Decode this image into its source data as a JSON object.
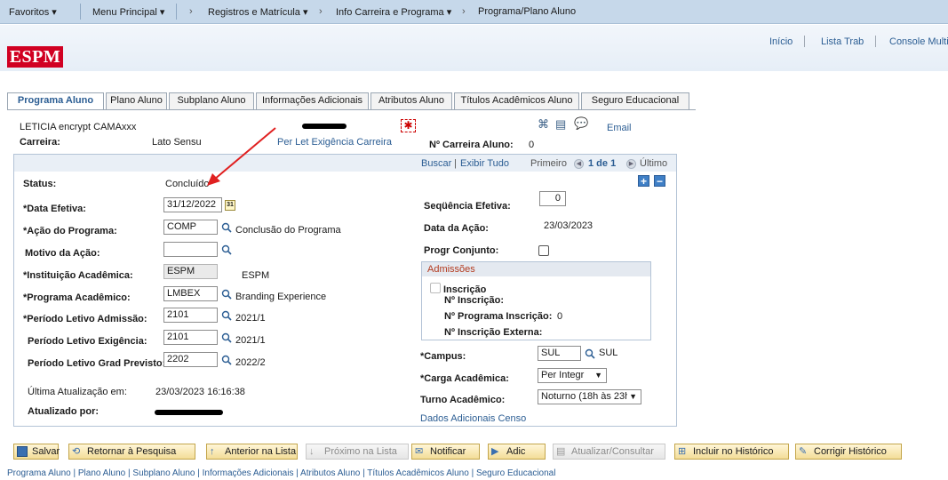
{
  "nav": {
    "favoritos": "Favoritos ▾",
    "menu_principal": "Menu Principal ▾",
    "sep": "›",
    "registros": "Registros e Matrícula ▾",
    "info_carreira": "Info Carreira e Programa ▾",
    "programa_plano": "Programa/Plano Aluno"
  },
  "header": {
    "logo": "ESPM",
    "links": {
      "inicio": "Início",
      "lista_trab": "Lista Trab",
      "console": "Console Multic"
    }
  },
  "tabs": [
    "Programa Aluno",
    "Plano Aluno",
    "Subplano Aluno",
    "Informações Adicionais",
    "Atributos Aluno",
    "Títulos Acadêmicos Aluno",
    "Seguro Educacional"
  ],
  "student": {
    "name": "LETICIA encrypt CAMAxxx",
    "carreira_label": "Carreira:",
    "carreira_value": "Lato Sensu",
    "per_let_link": "Per Let Exigência Carreira",
    "n_carreira_label": "Nº Carreira Aluno:",
    "n_carreira_value": "0",
    "email": "Email"
  },
  "grid_nav": {
    "buscar": "Buscar",
    "divider": "|",
    "exibir_tudo": "Exibir Tudo",
    "primeiro": "Primeiro",
    "count": "1 de 1",
    "ultimo": "Último"
  },
  "form": {
    "status_label": "Status:",
    "status_value": "Concluído",
    "data_efetiva_label": "*Data Efetiva:",
    "data_efetiva_value": "31/12/2022",
    "acao_label": "*Ação do Programa:",
    "acao_value": "COMP",
    "acao_desc": "Conclusão do Programa",
    "motivo_label": "Motivo da Ação:",
    "motivo_value": "",
    "instituicao_label": "*Instituição Acadêmica:",
    "instituicao_value": "ESPM",
    "instituicao_desc": "ESPM",
    "programa_label": "*Programa Acadêmico:",
    "programa_value": "LMBEX",
    "programa_desc": "Branding Experience",
    "periodo_adm_label": "*Período Letivo Admissão:",
    "periodo_adm_value": "2101",
    "periodo_adm_desc": "2021/1",
    "periodo_exig_label": "Período Letivo Exigência:",
    "periodo_exig_value": "2101",
    "periodo_exig_desc": "2021/1",
    "periodo_grad_label": "Período Letivo Grad Previsto:",
    "periodo_grad_value": "2202",
    "periodo_grad_desc": "2022/2",
    "ultima_label": "Última Atualização em:",
    "ultima_value": "23/03/2023 16:16:38",
    "atualizado_label": "Atualizado por:",
    "sequencia_label": "Seqüência Efetiva:",
    "sequencia_value": "0",
    "data_acao_label": "Data da Ação:",
    "data_acao_value": "23/03/2023",
    "progr_conjunto_label": "Progr Conjunto:",
    "admissoes_title": "Admissões",
    "inscricao_label": "Inscrição",
    "n_inscricao_label": "Nº Inscrição:",
    "n_prog_inscricao_label": "Nº Programa Inscrição:",
    "n_prog_inscricao_value": "0",
    "n_inscricao_externa_label": "Nº Inscrição Externa:",
    "campus_label": "*Campus:",
    "campus_value": "SUL",
    "campus_desc": "SUL",
    "carga_label": "*Carga Acadêmica:",
    "carga_value": "Per Integr",
    "turno_label": "Turno Acadêmico:",
    "turno_value": "Noturno (18h às 23h",
    "dados_link": "Dados Adicionais Censo"
  },
  "buttons": {
    "salvar": "Salvar",
    "retornar": "Retornar à Pesquisa",
    "anterior": "Anterior na Lista",
    "proximo": "Próximo na Lista",
    "notificar": "Notificar",
    "adic": "Adic",
    "atualizar": "Atualizar/Consultar",
    "incluir": "Incluir no Histórico",
    "corrigir": "Corrigir Histórico"
  },
  "bottom_links": "Programa Aluno | Plano Aluno | Subplano Aluno | Informações Adicionais | Atributos Aluno | Títulos Acadêmicos Aluno | Seguro Educacional",
  "colors": {
    "accent_red": "#d10022",
    "link_blue": "#2b5d93",
    "nav_bg": "#c6d8ea"
  }
}
